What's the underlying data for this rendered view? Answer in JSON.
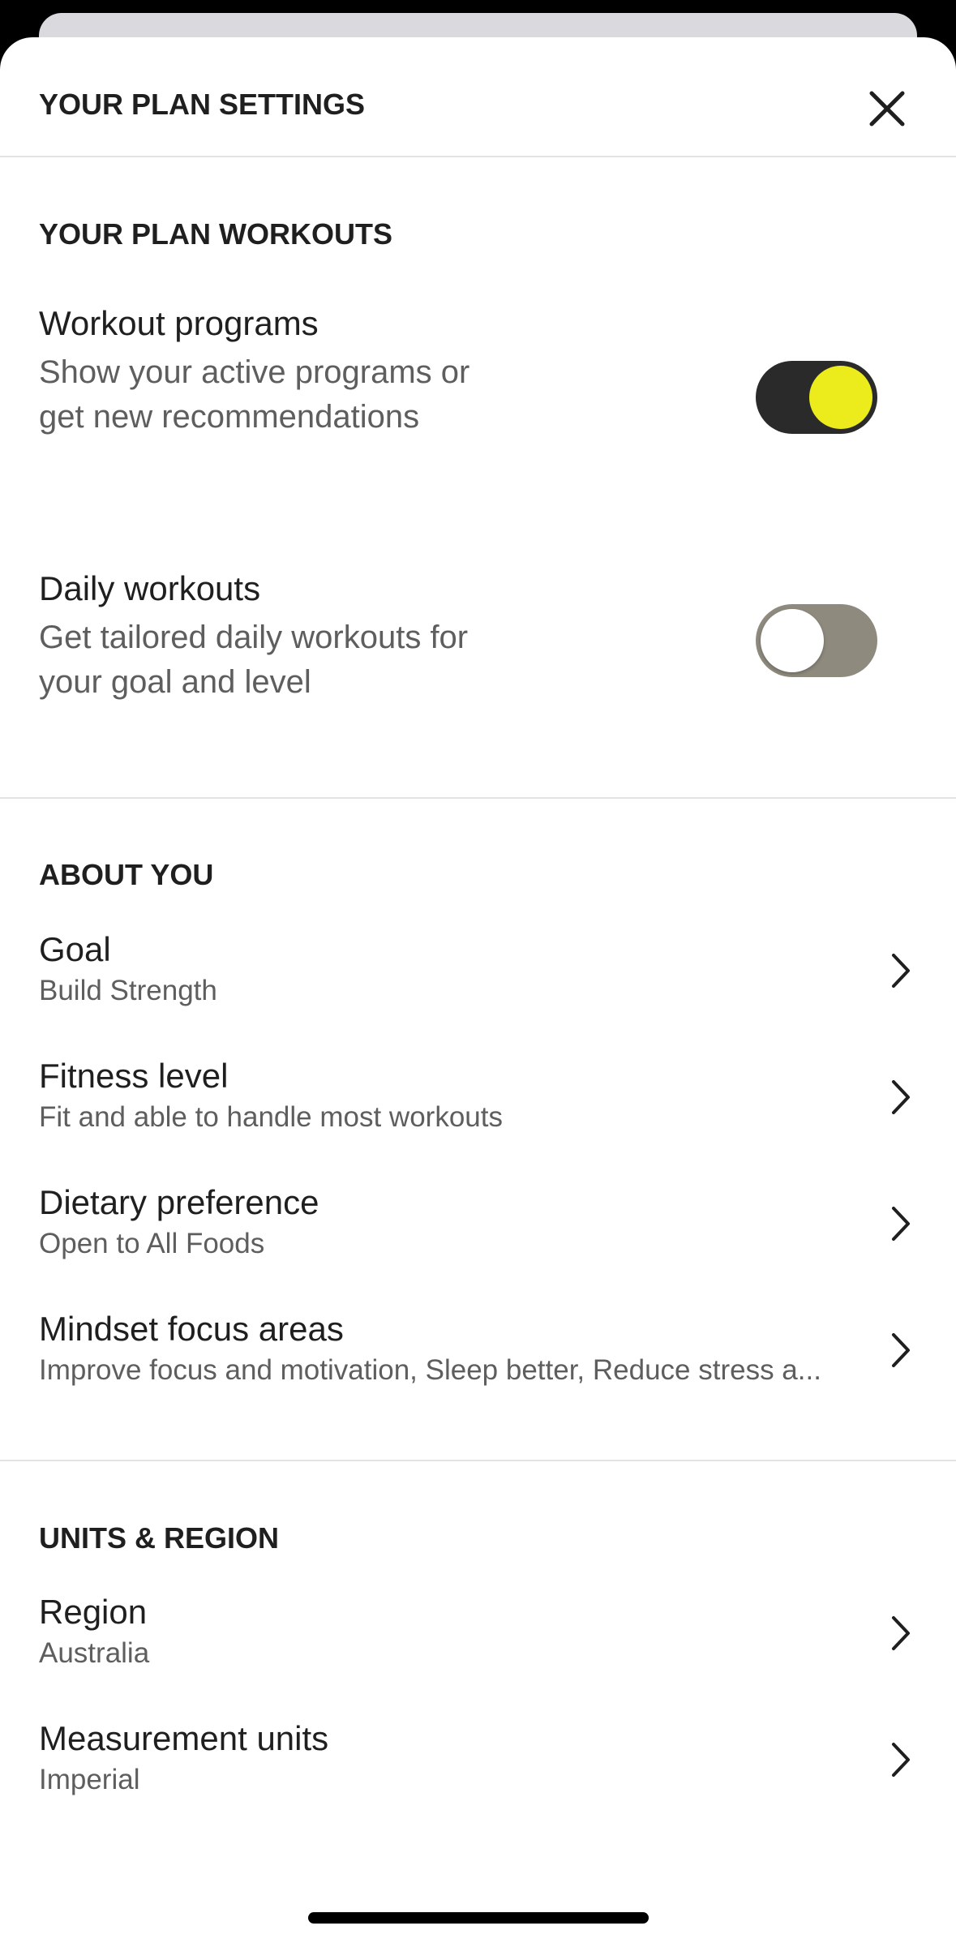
{
  "header": {
    "title": "YOUR PLAN SETTINGS",
    "close_icon": "close-icon"
  },
  "workouts_section": {
    "title": "YOUR PLAN WORKOUTS",
    "items": [
      {
        "title": "Workout programs",
        "description": "Show your active programs or get new recommendations",
        "enabled": true
      },
      {
        "title": "Daily workouts",
        "description": "Get tailored daily workouts for your goal and level",
        "enabled": false
      }
    ]
  },
  "about_section": {
    "title": "ABOUT YOU",
    "items": [
      {
        "title": "Goal",
        "value": "Build Strength"
      },
      {
        "title": "Fitness level",
        "value": "Fit and able to handle most workouts"
      },
      {
        "title": "Dietary preference",
        "value": "Open to All Foods"
      },
      {
        "title": "Mindset focus areas",
        "value": "Improve focus and motivation, Sleep better, Reduce stress a..."
      }
    ]
  },
  "units_section": {
    "title": "UNITS & REGION",
    "items": [
      {
        "title": "Region",
        "value": "Australia"
      },
      {
        "title": "Measurement units",
        "value": "Imperial"
      }
    ]
  },
  "colors": {
    "toggle_on_track": "#2a2a2a",
    "toggle_on_knob": "#ecec1c",
    "toggle_off_track": "#8e8a7e",
    "text_primary": "#1f1f1f",
    "text_secondary": "#5e5e5e"
  }
}
